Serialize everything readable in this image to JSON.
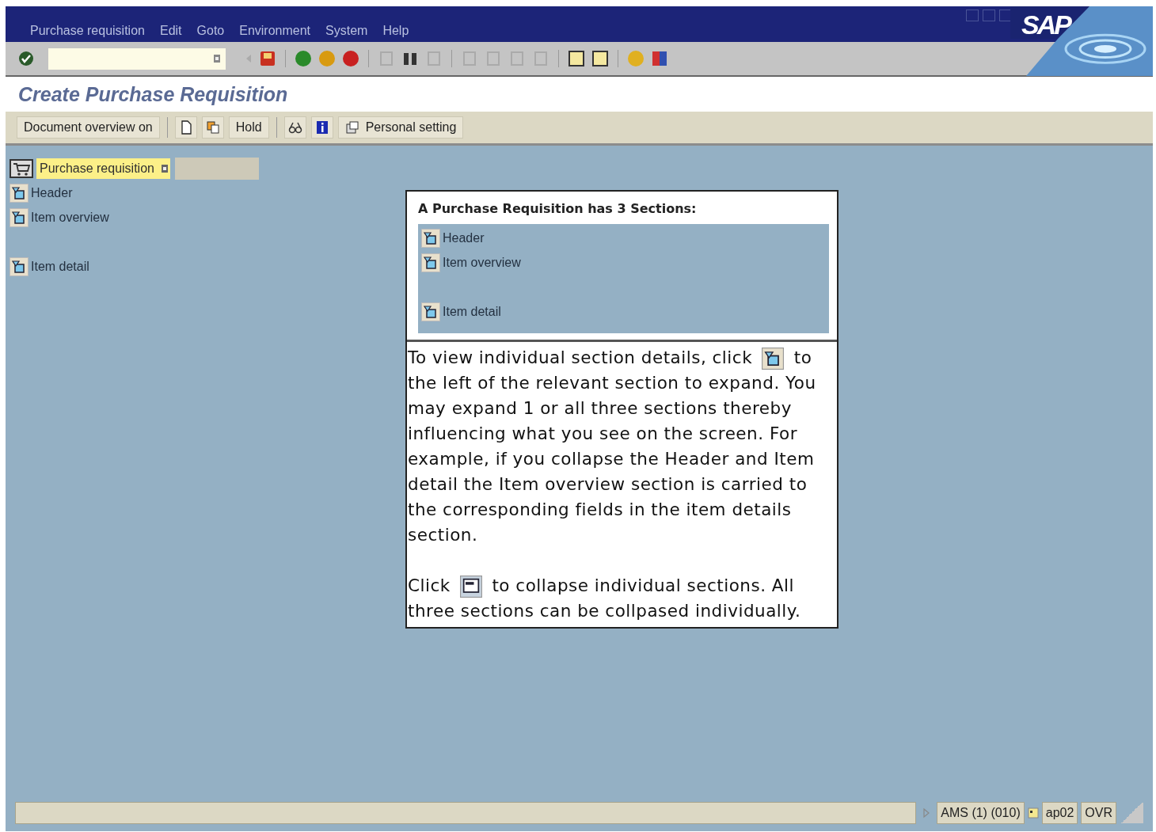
{
  "menu_bar": {
    "items": [
      "Purchase requisition",
      "Edit",
      "Goto",
      "Environment",
      "System",
      "Help"
    ]
  },
  "logo": "SAP",
  "screen_title": "Create Purchase Requisition",
  "app_toolbar": {
    "buttons": [
      {
        "kind": "text",
        "label": "Document overview on"
      },
      {
        "kind": "icon"
      },
      {
        "kind": "icon"
      },
      {
        "kind": "text",
        "label": "Hold"
      },
      {
        "kind": "icon"
      },
      {
        "kind": "icon"
      },
      {
        "kind": "icon_text",
        "label": "Personal setting"
      }
    ]
  },
  "tree": {
    "root": {
      "label": "Purchase requisition",
      "selected": true
    },
    "sections": [
      {
        "label": "Header",
        "gap_before": false
      },
      {
        "label": "Item overview",
        "gap_before": false
      },
      {
        "label": "Item detail",
        "gap_before": true
      }
    ]
  },
  "callout": {
    "title": "A Purchase Requisition has 3 Sections:",
    "sections": [
      {
        "label": "Header",
        "gap_before": false
      },
      {
        "label": "Item overview",
        "gap_before": false
      },
      {
        "label": "Item detail",
        "gap_before": true
      }
    ],
    "paragraphs": [
      {
        "before_icon": "To view individual section details, click",
        "after_icon": "to the left of the relevant section to expand. You may expand 1 or all three sections thereby influencing what you see on the screen. For example, if you collapse the Header and Item detail the Item overview section is carried to the corresponding fields in the item details section."
      },
      {
        "before_icon": "Click",
        "after_icon": "to collapse individual sections. All three sections can be collpased individually."
      }
    ]
  },
  "status_bar": {
    "fields": [
      "AMS (1) (010)",
      "ap02",
      "OVR"
    ]
  }
}
